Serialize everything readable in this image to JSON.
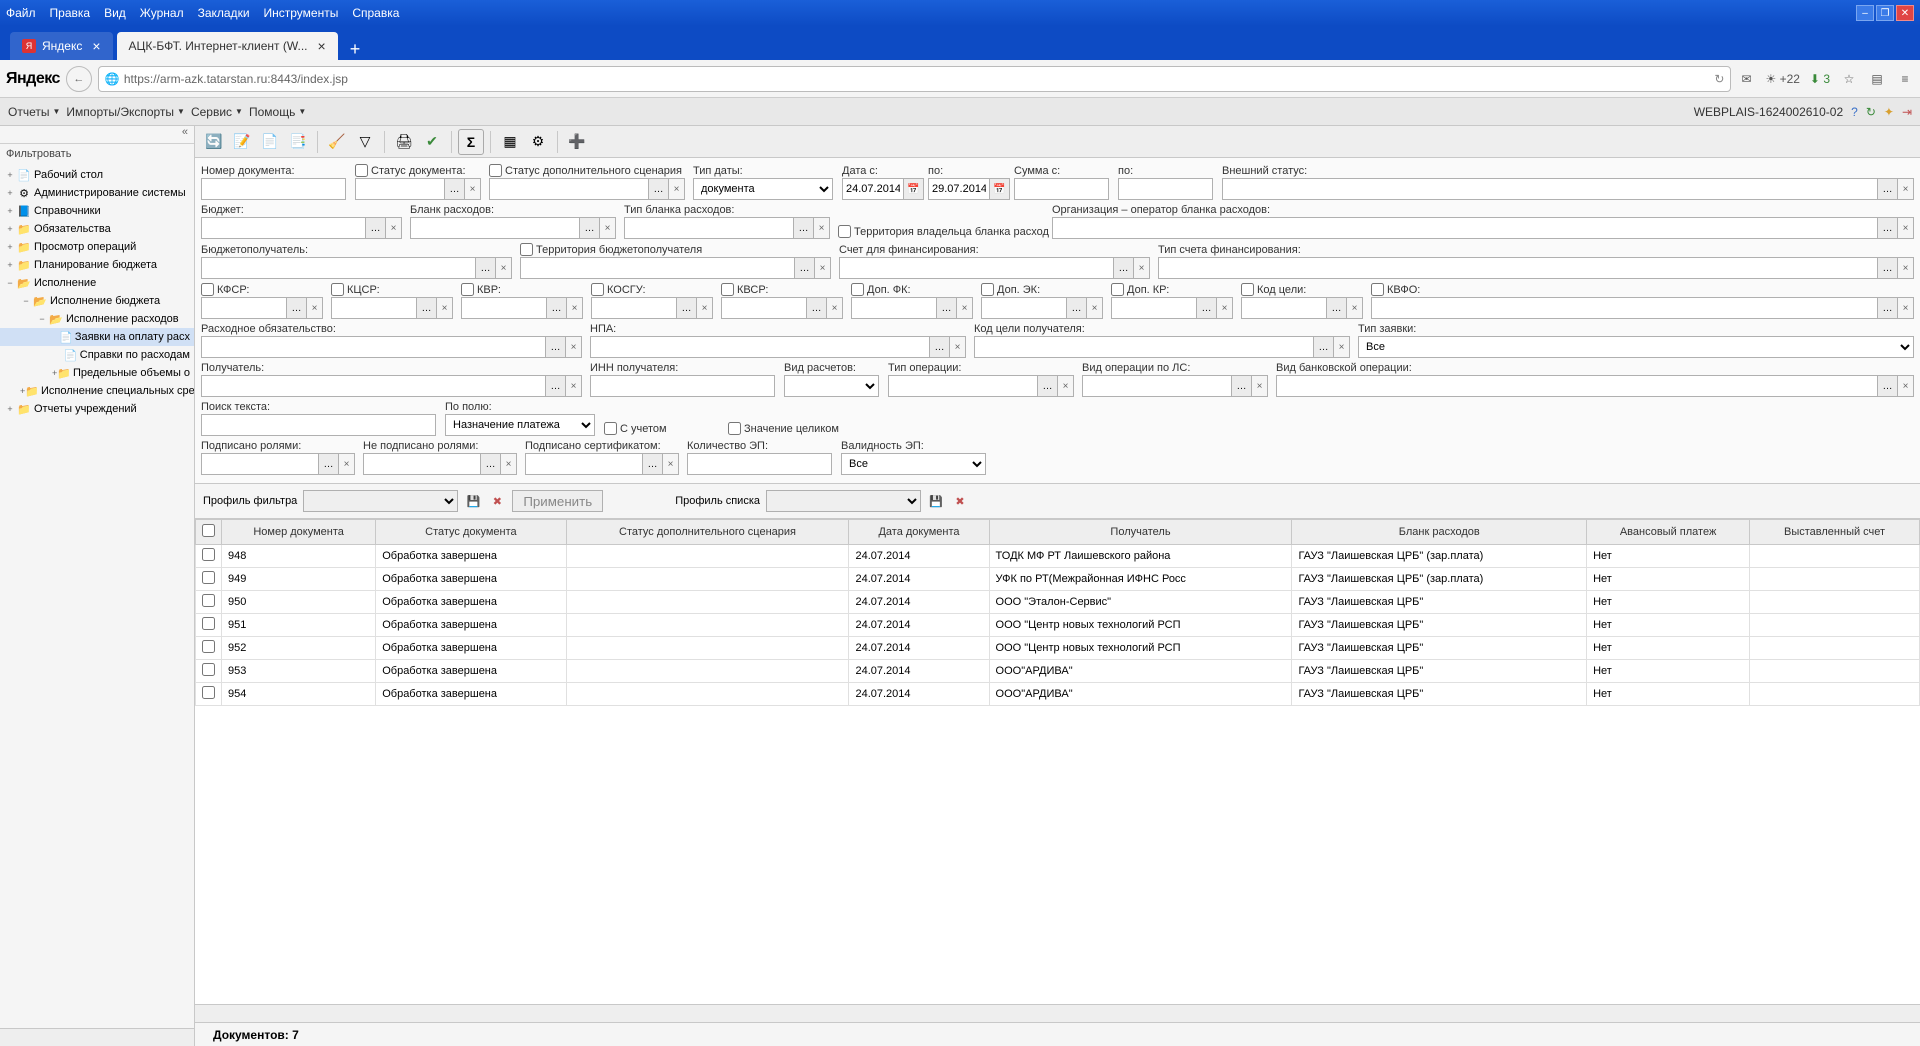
{
  "browser": {
    "menu": [
      "Файл",
      "Правка",
      "Вид",
      "Журнал",
      "Закладки",
      "Инструменты",
      "Справка"
    ],
    "tabs": [
      {
        "title": "Яндекс",
        "active": false
      },
      {
        "title": "АЦК-БФТ. Интернет-клиент (W...",
        "active": true
      }
    ],
    "yandex": "Яндекс",
    "url": "https://arm-azk.tatarstan.ru:8443/index.jsp",
    "weather": "+22",
    "downloads": "3"
  },
  "app_menu": {
    "items": [
      "Отчеты",
      "Импорты/Экспорты",
      "Сервис",
      "Помощь"
    ],
    "user_info": "WEBPLAIS-1624002610-02"
  },
  "sidebar": {
    "filter_label": "Фильтровать",
    "nodes": [
      {
        "label": "Рабочий стол",
        "icon": "doc",
        "exp": "+",
        "indent": 0
      },
      {
        "label": "Администрирование системы",
        "icon": "gear",
        "exp": "+",
        "indent": 0
      },
      {
        "label": "Справочники",
        "icon": "book",
        "exp": "+",
        "indent": 0
      },
      {
        "label": "Обязательства",
        "icon": "folder",
        "exp": "+",
        "indent": 0
      },
      {
        "label": "Просмотр операций",
        "icon": "folder",
        "exp": "+",
        "indent": 0
      },
      {
        "label": "Планирование бюджета",
        "icon": "folder",
        "exp": "+",
        "indent": 0
      },
      {
        "label": "Исполнение",
        "icon": "folder-open",
        "exp": "−",
        "indent": 0
      },
      {
        "label": "Исполнение бюджета",
        "icon": "folder-open",
        "exp": "−",
        "indent": 1
      },
      {
        "label": "Исполнение расходов",
        "icon": "folder-open",
        "exp": "−",
        "indent": 2
      },
      {
        "label": "Заявки на оплату расх",
        "icon": "doc",
        "exp": "",
        "indent": 3,
        "selected": true
      },
      {
        "label": "Справки по расходам",
        "icon": "doc",
        "exp": "",
        "indent": 3
      },
      {
        "label": "Предельные объемы о",
        "icon": "folder",
        "exp": "+",
        "indent": 3
      },
      {
        "label": "Исполнение специальных сред",
        "icon": "folder",
        "exp": "+",
        "indent": 1
      },
      {
        "label": "Отчеты учреждений",
        "icon": "folder",
        "exp": "+",
        "indent": 0
      }
    ]
  },
  "filters": {
    "doc_number": "Номер документа:",
    "doc_status": "Статус документа:",
    "add_scenario_status": "Статус дополнительного сценария",
    "date_type": "Тип даты:",
    "date_type_val": "документа",
    "date_from": "Дата с:",
    "date_from_val": "24.07.2014",
    "date_to": "по:",
    "date_to_val": "29.07.2014",
    "sum_from": "Сумма с:",
    "sum_to": "по:",
    "ext_status": "Внешний статус:",
    "budget": "Бюджет:",
    "blank": "Бланк расходов:",
    "blank_type": "Тип бланка расходов:",
    "territory_owner": "Территория владельца бланка расход",
    "org_operator": "Организация – оператор бланка расходов:",
    "budget_recipient": "Бюджетополучатель:",
    "territory_recipient": "Территория бюджетополучателя",
    "fin_account": "Счет для финансирования:",
    "fin_account_type": "Тип счета финансирования:",
    "kfsr": "КФСР:",
    "kcsr": "КЦСР:",
    "kvr": "КВР:",
    "kosgu": "КОСГУ:",
    "kvsr": "КВСР:",
    "dop_fk": "Доп. ФК:",
    "dop_ek": "Доп. ЭК:",
    "dop_kr": "Доп. КР:",
    "kod_celi": "Код цели:",
    "kvfo": "КВФО:",
    "expense_commitment": "Расходное обязательство:",
    "npa": "НПА:",
    "kod_celi_rec": "Код цели получателя:",
    "request_type": "Тип заявки:",
    "request_type_val": "Все",
    "recipient": "Получатель:",
    "recipient_inn": "ИНН получателя:",
    "calc_type": "Вид расчетов:",
    "op_type": "Тип операции:",
    "op_type_ls": "Вид операции по ЛС:",
    "bank_op_type": "Вид банковской операции:",
    "search_text": "Поиск текста:",
    "by_field": "По полю:",
    "by_field_val": "Назначение платежа",
    "with_register": "С учетом",
    "whole_value": "Значение целиком",
    "signed_roles": "Подписано ролями:",
    "not_signed_roles": "Не подписано ролями:",
    "signed_cert": "Подписано сертификатом:",
    "ep_count": "Количество ЭП:",
    "ep_validity": "Валидность ЭП:",
    "ep_validity_val": "Все"
  },
  "profile": {
    "filter_label": "Профиль фильтра",
    "apply": "Применить",
    "list_label": "Профиль списка"
  },
  "grid": {
    "columns": [
      "",
      "Номер документа",
      "Статус документа",
      "Статус дополнительного сценария",
      "Дата документа",
      "Получатель",
      "Бланк расходов",
      "Авансовый платеж",
      "Выставленный счет"
    ],
    "rows": [
      {
        "num": "948",
        "status": "Обработка завершена",
        "scenario": "",
        "date": "24.07.2014",
        "recipient": "ТОДК МФ РТ Лаишевского района",
        "blank": "ГАУЗ \"Лаишевская ЦРБ\" (зар.плата)",
        "advance": "Нет"
      },
      {
        "num": "949",
        "status": "Обработка завершена",
        "scenario": "",
        "date": "24.07.2014",
        "recipient": "УФК по РТ(Межрайонная ИФНС Росс",
        "blank": "ГАУЗ \"Лаишевская ЦРБ\" (зар.плата)",
        "advance": "Нет"
      },
      {
        "num": "950",
        "status": "Обработка завершена",
        "scenario": "",
        "date": "24.07.2014",
        "recipient": "ООО \"Эталон-Сервис\"",
        "blank": "ГАУЗ \"Лаишевская ЦРБ\"",
        "advance": "Нет"
      },
      {
        "num": "951",
        "status": "Обработка завершена",
        "scenario": "",
        "date": "24.07.2014",
        "recipient": "ООО \"Центр новых технологий РСП",
        "blank": "ГАУЗ \"Лаишевская ЦРБ\"",
        "advance": "Нет"
      },
      {
        "num": "952",
        "status": "Обработка завершена",
        "scenario": "",
        "date": "24.07.2014",
        "recipient": "ООО \"Центр новых технологий РСП",
        "blank": "ГАУЗ \"Лаишевская ЦРБ\"",
        "advance": "Нет"
      },
      {
        "num": "953",
        "status": "Обработка завершена",
        "scenario": "",
        "date": "24.07.2014",
        "recipient": "ООО\"АРДИВА\"",
        "blank": "ГАУЗ \"Лаишевская ЦРБ\"",
        "advance": "Нет"
      },
      {
        "num": "954",
        "status": "Обработка завершена",
        "scenario": "",
        "date": "24.07.2014",
        "recipient": "ООО\"АРДИВА\"",
        "blank": "ГАУЗ \"Лаишевская ЦРБ\"",
        "advance": "Нет"
      }
    ]
  },
  "status": {
    "label": "Документов:",
    "count": "7"
  }
}
